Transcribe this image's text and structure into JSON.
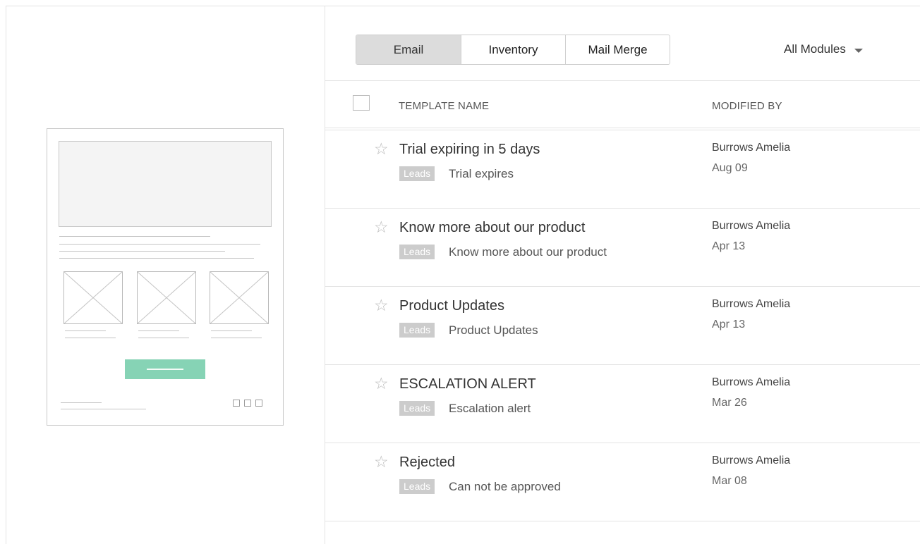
{
  "tabs": [
    {
      "label": "Email",
      "active": true
    },
    {
      "label": "Inventory",
      "active": false
    },
    {
      "label": "Mail Merge",
      "active": false
    }
  ],
  "module_filter": {
    "label": "All Modules"
  },
  "table": {
    "columns": [
      "TEMPLATE NAME",
      "MODIFIED BY"
    ],
    "rows": [
      {
        "name": "Trial expiring in 5 days",
        "tag": "Leads",
        "subject": "Trial expires",
        "modified_by": "Burrows Amelia",
        "date": "Aug 09"
      },
      {
        "name": "Know more about our product",
        "tag": "Leads",
        "subject": "Know more about our product",
        "modified_by": "Burrows Amelia",
        "date": "Apr 13"
      },
      {
        "name": "Product Updates",
        "tag": "Leads",
        "subject": "Product Updates",
        "modified_by": "Burrows Amelia",
        "date": "Apr 13"
      },
      {
        "name": "ESCALATION ALERT",
        "tag": "Leads",
        "subject": "Escalation alert",
        "modified_by": "Burrows Amelia",
        "date": "Mar 26"
      },
      {
        "name": "Rejected",
        "tag": "Leads",
        "subject": "Can not be approved",
        "modified_by": "Burrows Amelia",
        "date": "Mar 08"
      }
    ]
  },
  "colors": {
    "accent_button": "#86d3b5",
    "active_tab": "#dcdcdc",
    "tag_bg": "#cccccc"
  },
  "icons": {
    "star": "star-outline-icon",
    "caret": "caret-down-icon",
    "placeholder": "image-placeholder-icon"
  }
}
